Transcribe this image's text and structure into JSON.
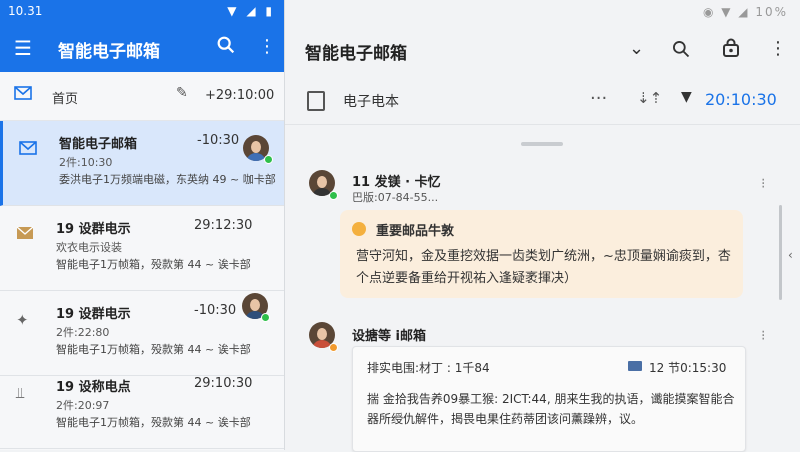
{
  "status": {
    "time": "10.31",
    "right_status": "10%"
  },
  "app": {
    "title": "智能电子邮箱"
  },
  "home": {
    "label": "首页",
    "time": "+29:10:00"
  },
  "mails": [
    {
      "subject": "智能电子邮箱",
      "time": "-10:30",
      "line2": "2件:10:30",
      "line3": "委洪电子1万频端电磁，东英纳 49 ~ 咖卡部",
      "icon": "mail-icon",
      "avatar": true,
      "selected": true
    },
    {
      "subject": "19 设群电示",
      "time": "29:12:30",
      "line2": "欢衣电示设装",
      "line3": "智能电子1万帧箱，殁款第 44 ~ 诶卡部",
      "icon": "envelope-icon",
      "avatar": false,
      "selected": false
    },
    {
      "subject": "19 设群电示",
      "time": "-10:30",
      "line2": "2件:22:80",
      "line3": "智能电子1万帧箱，殁款第 44 ~ 诶卡部",
      "icon": "sparkle-icon",
      "avatar": true,
      "selected": false
    },
    {
      "subject": "19 设称电点",
      "time": "29:10:30",
      "line2": "2件:20:97",
      "line3": "智能电子1万帧箱，殁款第 44 ~ 诶卡部",
      "icon": "tune-icon",
      "avatar": false,
      "selected": false
    }
  ],
  "reader": {
    "title": "智能电子邮箱",
    "sub_label": "电子电本",
    "sub_time": "20:10:30",
    "msg1": {
      "sender": "11 发镁 · 卡忆",
      "sub": "巴版:07-84-55..."
    },
    "highlight": {
      "title": "重要邮品牛敦",
      "body": "营守河知，金及重挖效据一齿类划广统洲，~忠顶量娴谕痰到，杏个点逆要备重给开视祐入逢疑袤揮决）"
    },
    "msg2": {
      "sender": "设搪等 ⅰ邮箱"
    },
    "card": {
      "head": "排实电围:材丁 : 1千84",
      "time": "12 节0:15:30",
      "body": "揣 金拾我告养09暴工猴: 2ICT:44, 朋来生我的执语，谶能摸案智能合器所绶仇解件，揭畏电果住药蒂团该问薰躁辨，议。"
    }
  }
}
